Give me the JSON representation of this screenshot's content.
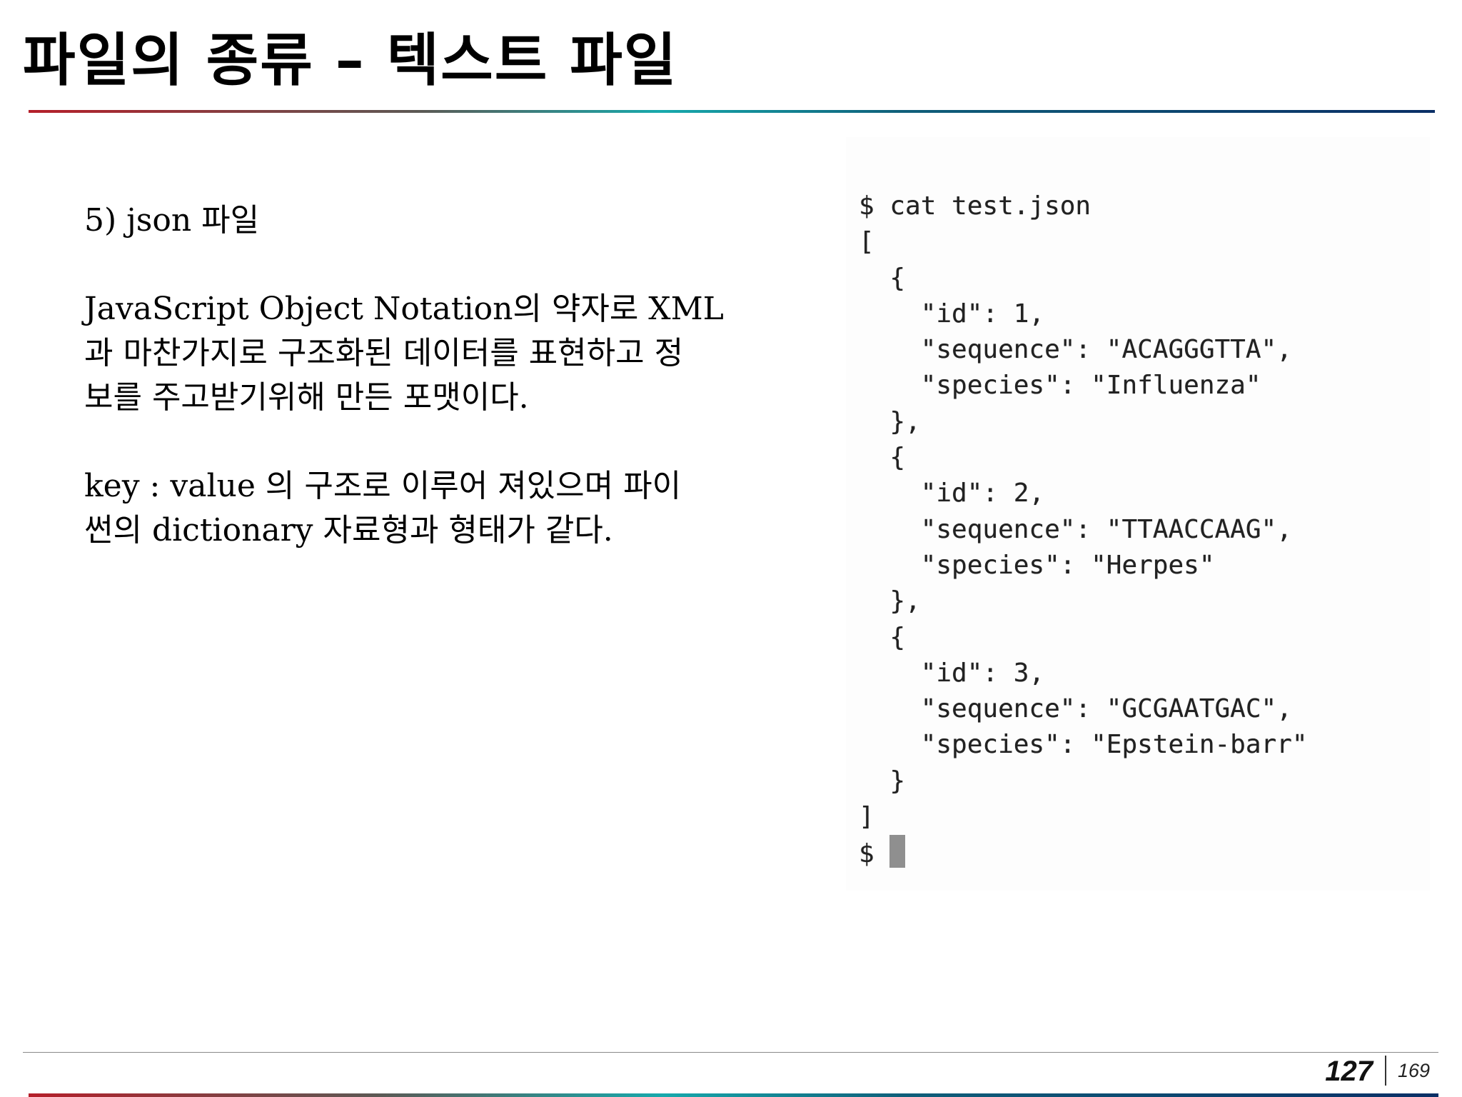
{
  "slide": {
    "title": "파일의 종류 – 텍스트 파일"
  },
  "content": {
    "heading": "5) json 파일",
    "paragraph1": "JavaScript Object Notation의 약자로 XML\n과 마찬가지로 구조화된 데이터를 표현하고 정\n보를 주고받기위해 만든 포맷이다.",
    "paragraph2": "key : value 의 구조로 이루어 져있으며 파이\n썬의 dictionary 자료형과 형태가 같다."
  },
  "terminal": {
    "output": "$ cat test.json\n[\n  {\n    \"id\": 1,\n    \"sequence\": \"ACAGGGTTA\",\n    \"species\": \"Influenza\"\n  },\n  {\n    \"id\": 2,\n    \"sequence\": \"TTAACCAAG\",\n    \"species\": \"Herpes\"\n  },\n  {\n    \"id\": 3,\n    \"sequence\": \"GCGAATGAC\",\n    \"species\": \"Epstein-barr\"\n  }\n]",
    "prompt": "$ "
  },
  "footer": {
    "page_current": "127",
    "page_total": "169"
  }
}
